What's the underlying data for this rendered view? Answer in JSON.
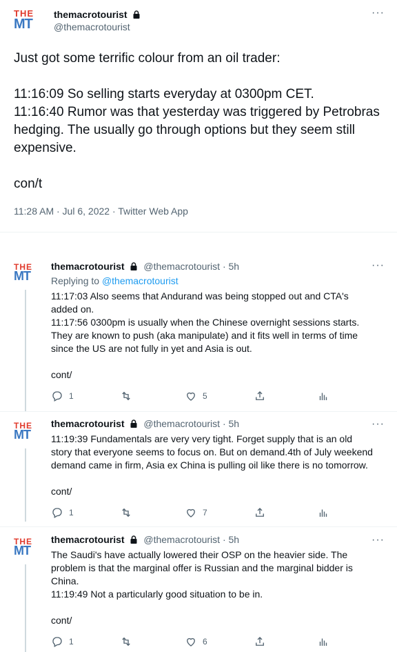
{
  "main_tweet": {
    "display_name": "themacrotourist",
    "handle": "@themacrotourist",
    "text": "Just got some terrific colour from an oil trader:\n\n11:16:09 So selling starts everyday at 0300pm CET.\n11:16:40 Rumor was that yesterday was triggered by Petrobras hedging. The usually go through options but they seem still expensive.\n\ncon/t",
    "meta": "11:28 AM · Jul 6, 2022 · Twitter Web App"
  },
  "logo": {
    "top": "THE",
    "bottom": "MT"
  },
  "colors": {
    "accent": "#1d9bf0",
    "logo_red": "#e0392b",
    "logo_blue": "#3a78c2",
    "muted": "#536471"
  },
  "replies": [
    {
      "display_name": "themacrotourist",
      "handle": "@themacrotourist · 5h",
      "replying_prefix": "Replying to",
      "replying_to": "@themacrotourist",
      "text": "11:17:03 Also seems that Andurand was being stopped out and CTA's added on.\n11:17:56 0300pm is usually when the Chinese overnight sessions starts. They are known to push (aka manipulate) and it fits well in terms of time since the US are not fully in yet and Asia is out.\n\ncont/",
      "reply_count": "1",
      "retweet_count": "",
      "like_count": "5"
    },
    {
      "display_name": "themacrotourist",
      "handle": "@themacrotourist · 5h",
      "text": "11:19:39 Fundamentals are very very tight. Forget supply that is an old story that everyone seems to focus on. But on demand.4th of July weekend demand came in firm, Asia ex China is pulling oil like there is no tomorrow.\n\ncont/",
      "reply_count": "1",
      "retweet_count": "",
      "like_count": "7"
    },
    {
      "display_name": "themacrotourist",
      "handle": "@themacrotourist · 5h",
      "text": "The Saudi's have actually lowered their OSP on the heavier side. The problem is that the marginal offer is Russian and the marginal bidder is China.\n11:19:49 Not a particularly good situation to be in.\n\ncont/",
      "reply_count": "1",
      "retweet_count": "",
      "like_count": "6"
    }
  ],
  "icons": {
    "more": "more-icon",
    "lock": "lock-icon",
    "reply": "reply-icon",
    "retweet": "retweet-icon",
    "like": "like-icon",
    "share": "share-icon",
    "analytics": "analytics-icon"
  }
}
